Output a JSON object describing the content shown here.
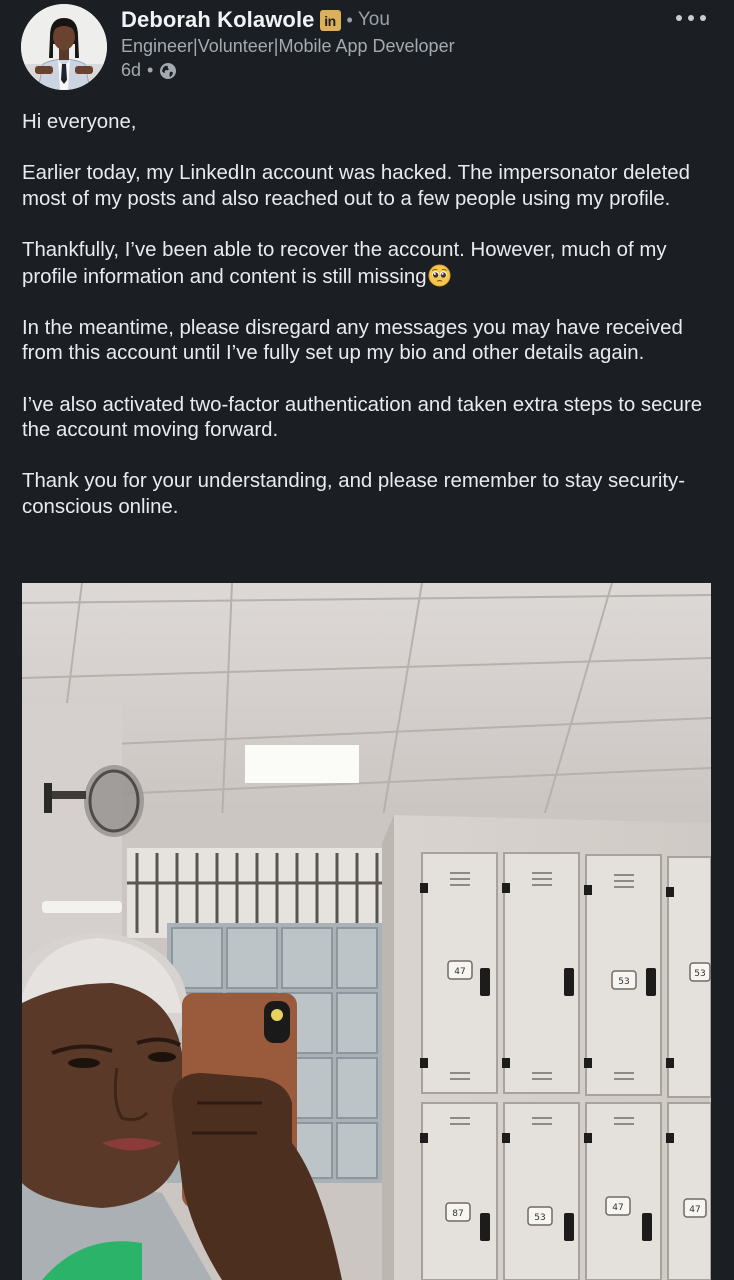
{
  "post": {
    "author": {
      "name": "Deborah Kolawole",
      "badge_icon": "linkedin-icon",
      "badge_text": "in",
      "separator": "•",
      "degree": "You",
      "headline": "Engineer|Volunteer|Mobile App Developer",
      "time": "6d",
      "time_separator": "•",
      "visibility_icon": "globe-icon"
    },
    "more_icon": "more-horizontal-icon",
    "paragraphs": [
      "Hi everyone,",
      "Earlier today, my LinkedIn account was hacked. The impersonator deleted most of my posts and also reached out to a few people using my profile.",
      "Thankfully, I’ve been able to recover the account. However, much of my profile information and content is still missing",
      "In the meantime, please disregard any messages you may have received from this account until I’ve fully set up my bio and other details again.",
      "I’ve also activated two-factor authentication and taken extra steps to secure the account moving forward.",
      "Thank you for your understanding, and please remember to stay security-conscious online."
    ],
    "emoji_icon": "pleading-face-emoji-icon",
    "image": {
      "locker_labels": [
        "47",
        "53",
        "53",
        "87",
        "53",
        "47",
        "47"
      ]
    }
  },
  "colors": {
    "background": "#1b1f23",
    "text": "#e9ebee",
    "secondary_text": "#a3aab1",
    "linkedin_badge": "#dcb056"
  }
}
